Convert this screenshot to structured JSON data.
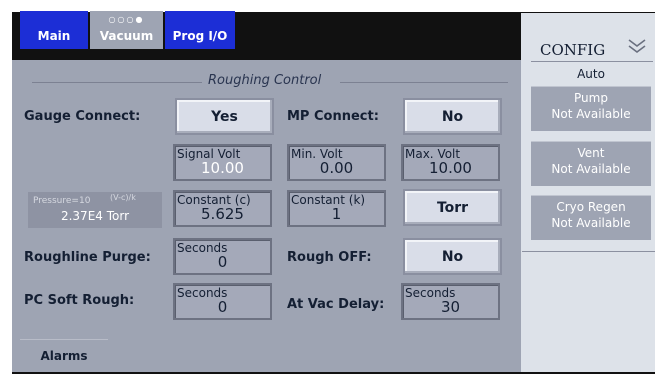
{
  "tabs": [
    {
      "label": "Main"
    },
    {
      "label": "Vacuum",
      "dots": "○○○●"
    },
    {
      "label": "Prog I/O"
    }
  ],
  "section_title": "Roughing Control",
  "rows": {
    "gauge_connect": {
      "label": "Gauge Connect:",
      "value": "Yes"
    },
    "mp_connect": {
      "label": "MP Connect:",
      "value": "No"
    },
    "signal_volt": {
      "caption": "Signal Volt",
      "value": "10.00"
    },
    "min_volt": {
      "caption": "Min. Volt",
      "value": "0.00"
    },
    "max_volt": {
      "caption": "Max. Volt",
      "value": "10.00"
    },
    "pressure_formula": "Pressure=10",
    "pressure_exponent": "(V-c)/k",
    "pressure_value": "2.37E4 Torr",
    "constant_c": {
      "caption": "Constant (c)",
      "value": "5.625"
    },
    "constant_k": {
      "caption": "Constant (k)",
      "value": "1"
    },
    "units": "Torr",
    "roughline_purge": {
      "label": "Roughline Purge:",
      "caption": "Seconds",
      "value": "0"
    },
    "rough_off": {
      "label": "Rough OFF:",
      "value": "No"
    },
    "pc_soft_rough": {
      "label": "PC Soft Rough:",
      "caption": "Seconds",
      "value": "0"
    },
    "at_vac_delay": {
      "label": "At Vac Delay:",
      "caption": "Seconds",
      "value": "30"
    }
  },
  "alarms_label": "Alarms",
  "sidebar": {
    "title": "CONFIG",
    "chevron_icon": "double-chevron-down-icon",
    "mode": "Auto",
    "items": [
      {
        "name": "Pump",
        "status": "Not Available"
      },
      {
        "name": "Vent",
        "status": "Not Available"
      },
      {
        "name": "Cryo Regen",
        "status": "Not Available"
      }
    ]
  },
  "colors": {
    "panel": "#9ea4b3",
    "tab_blue": "#1c2ed6",
    "button": "#d9dde8",
    "field": "#a4a9b9",
    "sidebar": "#dde2e9"
  }
}
